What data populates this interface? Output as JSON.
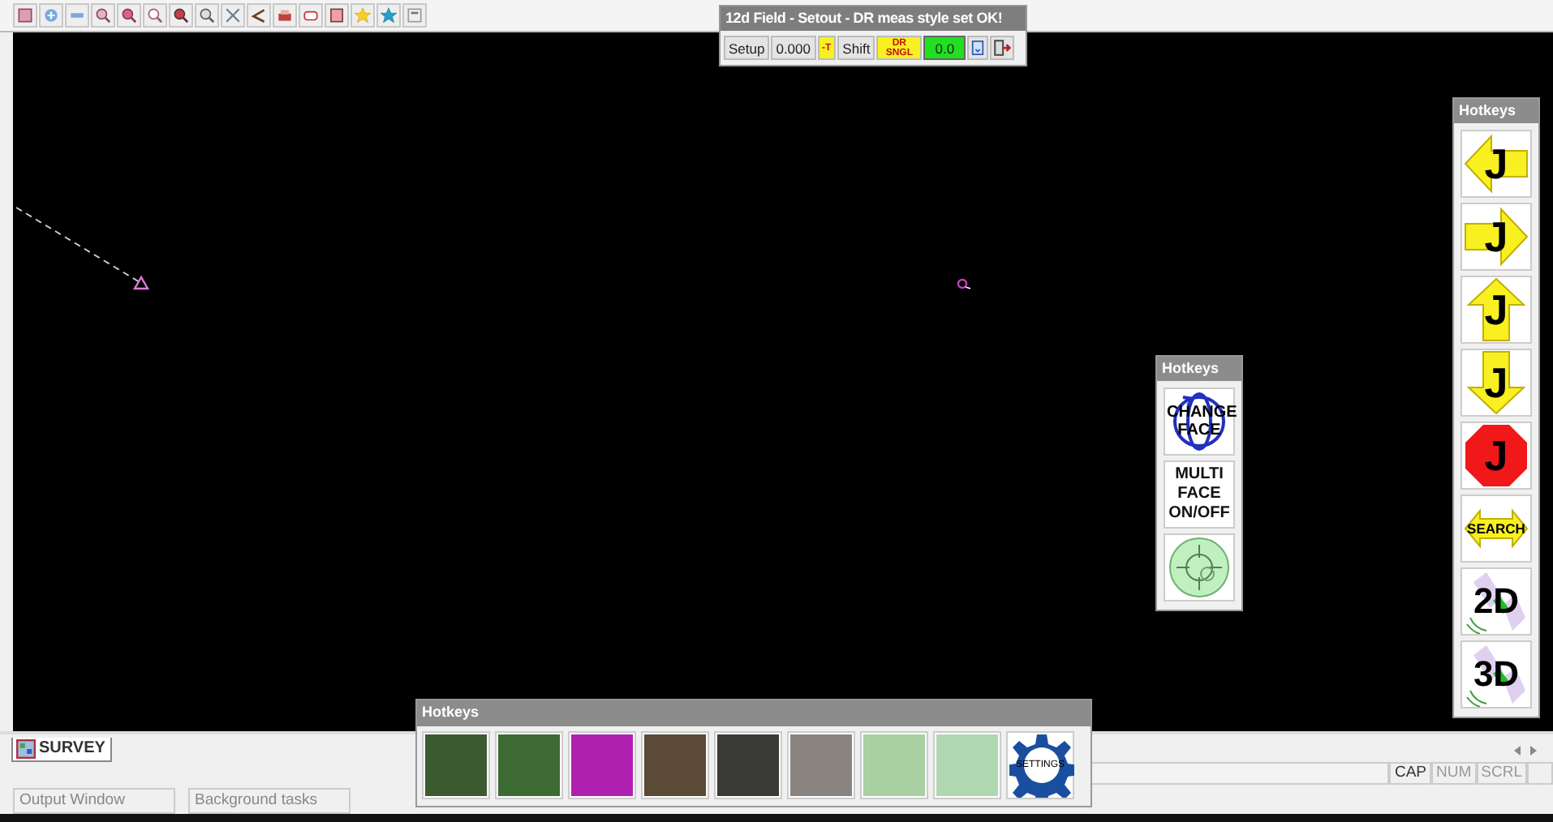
{
  "setout_panel": {
    "title": "12d Field - Setout - DR meas style set OK!",
    "controls": [
      {
        "kind": "button",
        "label": "Setup"
      },
      {
        "kind": "button",
        "label": "0.000"
      },
      {
        "kind": "flag",
        "label": "-T"
      },
      {
        "kind": "button",
        "label": "Shift"
      },
      {
        "kind": "flag",
        "label": "DR SNGL"
      },
      {
        "kind": "readout",
        "label": "0.0"
      }
    ]
  },
  "hotkeys_right": {
    "title": "Hotkeys",
    "buttons": [
      {
        "kind": "arrow-left",
        "label": "J"
      },
      {
        "kind": "arrow-right",
        "label": "J"
      },
      {
        "kind": "arrow-up",
        "label": "J"
      },
      {
        "kind": "arrow-down",
        "label": "J"
      },
      {
        "kind": "stop",
        "label": "J"
      },
      {
        "kind": "search",
        "label": "SEARCH"
      },
      {
        "kind": "view",
        "label": "2D"
      },
      {
        "kind": "view",
        "label": "3D"
      }
    ]
  },
  "hotkeys_middle": {
    "title": "Hotkeys",
    "buttons": [
      {
        "kind": "face",
        "label": "CHANGE FACE"
      },
      {
        "kind": "text",
        "label": "MULTI FACE ON/OFF"
      },
      {
        "kind": "bubble"
      }
    ]
  },
  "hotkeys_bottom": {
    "title": "Hotkeys",
    "buttons": [
      {
        "kind": "photo"
      },
      {
        "kind": "photo"
      },
      {
        "kind": "photo"
      },
      {
        "kind": "photo"
      },
      {
        "kind": "photo"
      },
      {
        "kind": "photo"
      },
      {
        "kind": "photo"
      },
      {
        "kind": "photo"
      },
      {
        "kind": "gear",
        "label": "SETTINGS"
      }
    ]
  },
  "document_tab": {
    "label": "SURVEY",
    "selected": true
  },
  "status_bar": {
    "indicators": [
      {
        "label": "CAP",
        "on": true
      },
      {
        "label": "NUM",
        "on": false
      },
      {
        "label": "SCRL",
        "on": false
      }
    ]
  },
  "bottom_tabs": [
    {
      "label": "Output Window",
      "selected": false
    },
    {
      "label": "Background tasks",
      "selected": false
    }
  ]
}
